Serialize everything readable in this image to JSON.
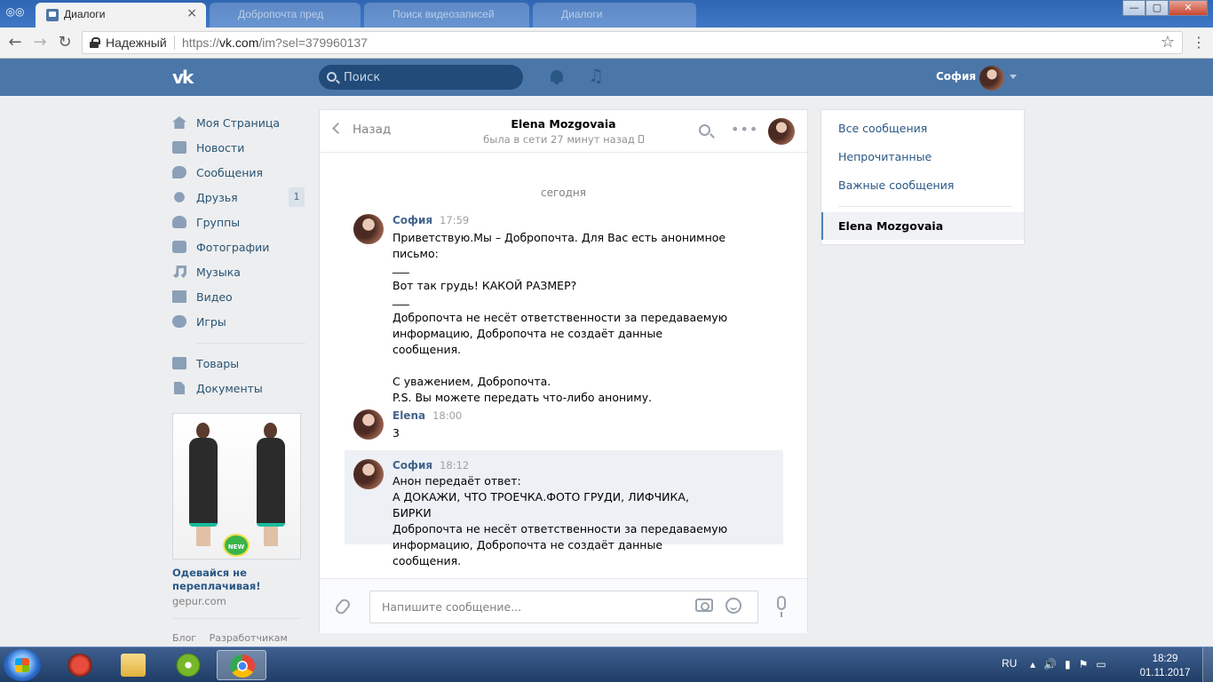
{
  "browser": {
    "tabs": [
      {
        "title": "Диалоги",
        "close": "×"
      },
      {
        "title": "Добропочта пред"
      },
      {
        "title": "Поиск видеозаписей"
      },
      {
        "title": "Диалоги"
      }
    ],
    "secure_label": "Надежный",
    "url_scheme": "https://",
    "url_host": "vk.com",
    "url_path": "/im?sel=379960137",
    "window_buttons": {
      "minimize": "—",
      "maximize": "▢",
      "close": "✕"
    }
  },
  "header": {
    "logo": "vk",
    "search_placeholder": "Поиск",
    "user_name": "София"
  },
  "leftnav": {
    "items": [
      {
        "label": "Моя Страница",
        "icon": "home-icon"
      },
      {
        "label": "Новости",
        "icon": "news-icon"
      },
      {
        "label": "Сообщения",
        "icon": "messages-icon"
      },
      {
        "label": "Друзья",
        "icon": "friends-icon",
        "badge": "1"
      },
      {
        "label": "Группы",
        "icon": "groups-icon"
      },
      {
        "label": "Фотографии",
        "icon": "camera-icon"
      },
      {
        "label": "Музыка",
        "icon": "music-icon"
      },
      {
        "label": "Видео",
        "icon": "video-icon"
      },
      {
        "label": "Игры",
        "icon": "gamepad-icon"
      }
    ],
    "items2": [
      {
        "label": "Товары",
        "icon": "bag-icon"
      },
      {
        "label": "Документы",
        "icon": "document-icon"
      }
    ],
    "ad": {
      "badge": "NEW",
      "title": "Одевайся не переплачивая!",
      "domain": "gepur.com"
    },
    "footer": [
      "Блог",
      "Разработчикам"
    ]
  },
  "chat": {
    "back_label": "Назад",
    "peer_name": "Elena Mozgovaia",
    "peer_status": "была в сети 27 минут назад",
    "day_label": "сегодня",
    "messages": [
      {
        "author": "София",
        "time": "17:59",
        "lines": [
          "Приветствую.Мы – Добропочта. Для Вас есть анонимное",
          "письмо:",
          "___",
          "Вот так грудь! КАКОЙ РАЗМЕР?",
          "___",
          "Добропочта не несёт ответственности за передаваемую",
          "информацию, Добропочта не создаёт данные сообщения.",
          "",
          "С уважением, Добропочта.",
          "P.S. Вы можете передать что-либо анониму."
        ]
      },
      {
        "author": "Elena",
        "time": "18:00",
        "lines": [
          "3"
        ]
      },
      {
        "author": "София",
        "time": "18:12",
        "lines": [
          "Анон передаёт ответ:",
          "А ДОКАЖИ, ЧТО ТРОЕЧКА.ФОТО ГРУДИ, ЛИФЧИКА, БИРКИ",
          "Добропочта не несёт ответственности за передаваемую",
          "информацию, Добропочта не создаёт данные сообщения."
        ]
      }
    ],
    "composer_placeholder": "Напишите сообщение..."
  },
  "rightpanel": {
    "items": [
      "Все сообщения",
      "Непрочитанные",
      "Важные сообщения"
    ],
    "active_dialog": "Elena Mozgovaia"
  },
  "taskbar": {
    "apps": [
      "ccleaner-icon",
      "explorer-icon",
      "utorrent-icon",
      "chrome-icon"
    ],
    "lang": "RU",
    "time": "18:29",
    "date": "01.11.2017"
  },
  "colors": {
    "vk_blue": "#4a76a8",
    "link": "#2a5885",
    "page_bg": "#edeef0"
  }
}
